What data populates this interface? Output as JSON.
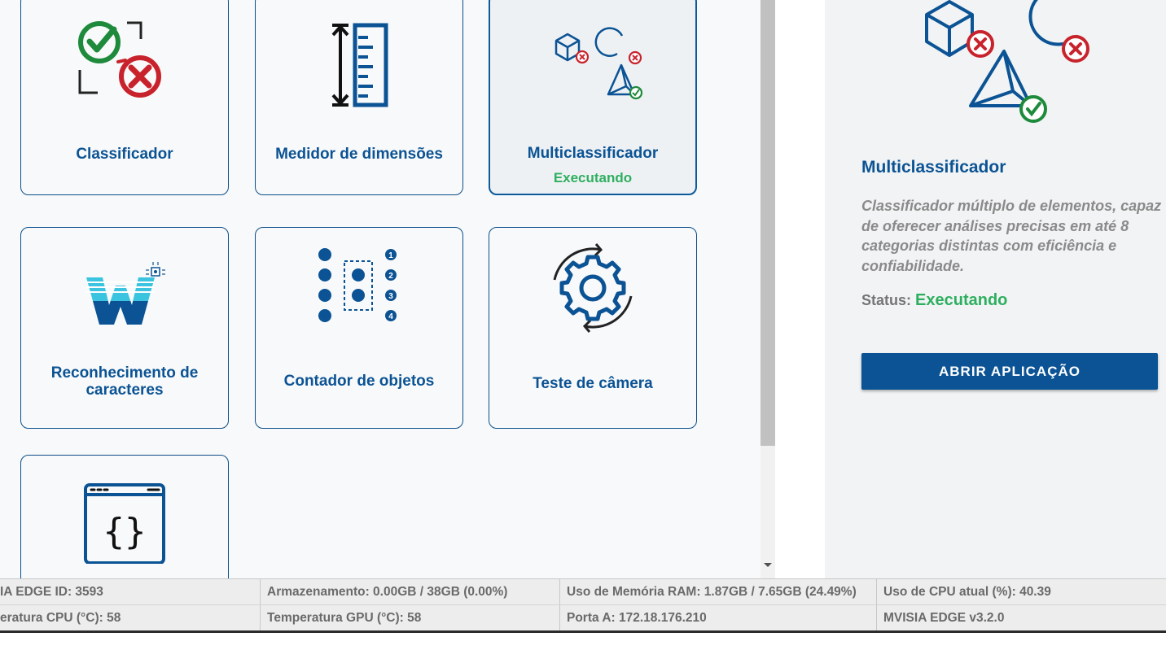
{
  "apps": [
    {
      "label": "Classificador",
      "icon": "classifier-check-cross-icon"
    },
    {
      "label": "Medidor de dimensões",
      "icon": "ruler-measure-icon"
    },
    {
      "label": "Multiclassificador",
      "icon": "multi-shapes-icon",
      "status": "Executando",
      "selected": true
    },
    {
      "label": "Reconhecimento de caracteres",
      "icon": "ocr-w-icon"
    },
    {
      "label": "Contador de objetos",
      "icon": "object-counter-icon"
    },
    {
      "label": "Teste de câmera",
      "icon": "gear-refresh-icon"
    },
    {
      "label": "",
      "icon": "code-window-icon"
    }
  ],
  "details": {
    "title": "Multiclassificador",
    "description": "Classificador múltiplo de elementos, capaz de oferecer análises precisas em até 8 categorias distintas com eficiência e confiabilidade.",
    "status_label": "Status:",
    "status_value": "Executando",
    "open_button": "ABRIR APLICAÇÃO"
  },
  "statusbar": {
    "row1": [
      "IA EDGE ID: 3593",
      "Armazenamento: 0.00GB / 38GB (0.00%)",
      "Uso de Memória RAM: 1.87GB / 7.65GB (24.49%)",
      "Uso de CPU atual (%): 40.39"
    ],
    "row2": [
      "eratura CPU (°C): 58",
      "Temperatura GPU (°C): 58",
      "Porta A: 172.18.176.210",
      "MVISIA EDGE v3.2.0"
    ]
  },
  "colors": {
    "brand": "#0b5394",
    "running": "#2eaf5f",
    "ok": "#1e8a3c",
    "error": "#c8232c"
  }
}
